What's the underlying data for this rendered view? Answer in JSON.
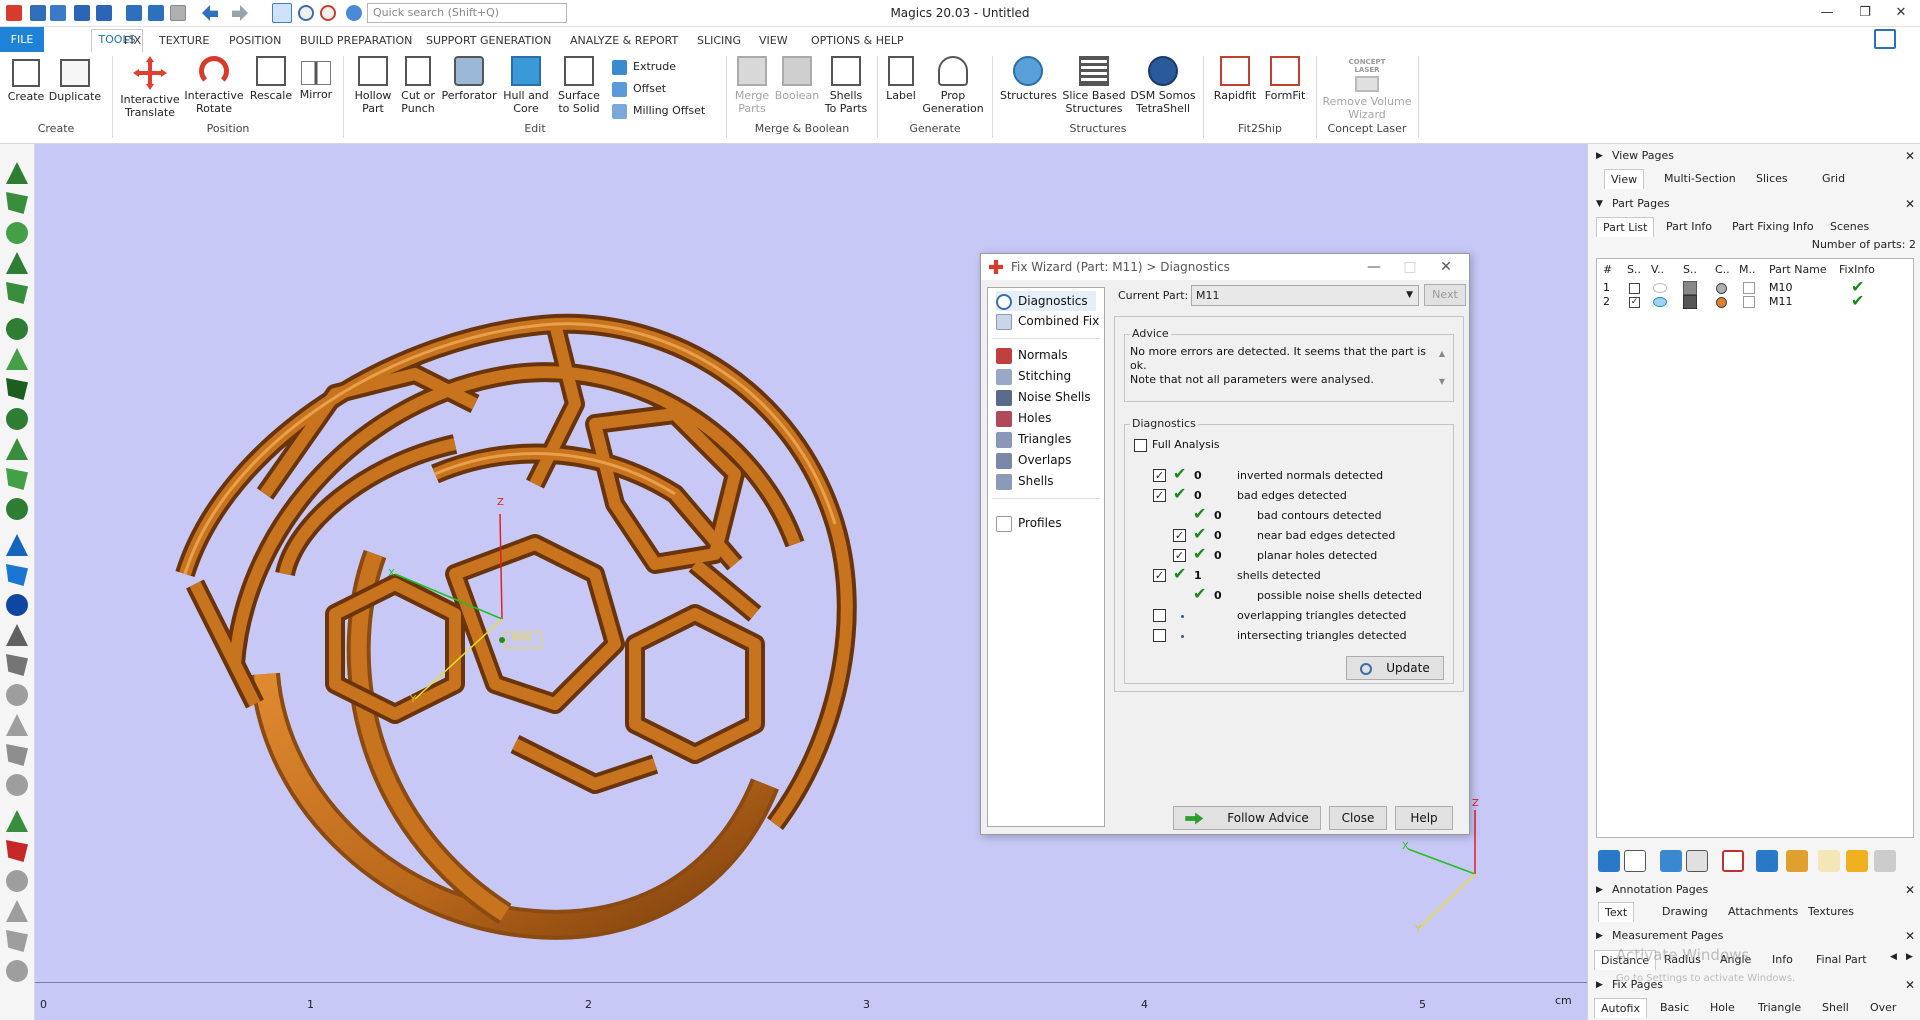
{
  "titlebar": {
    "title": "Magics 20.03 - Untitled",
    "search_placeholder": "Quick search (Shift+Q)"
  },
  "menu_tabs": [
    "FILE",
    "TOOLS",
    "FIX",
    "TEXTURE",
    "POSITION",
    "BUILD PREPARATION",
    "SUPPORT GENERATION",
    "ANALYZE & REPORT",
    "SLICING",
    "VIEW",
    "OPTIONS & HELP"
  ],
  "ribbon": {
    "create": {
      "create": "Create",
      "duplicate": "Duplicate",
      "group": "Create"
    },
    "position": {
      "translate": "Interactive\nTranslate",
      "rotate": "Interactive\nRotate",
      "rescale": "Rescale",
      "mirror": "Mirror",
      "group": "Position"
    },
    "edit": {
      "hollow": "Hollow\nPart",
      "cut": "Cut or\nPunch",
      "perforator": "Perforator",
      "hull": "Hull and\nCore",
      "surface": "Surface\nto Solid",
      "extrude": "Extrude",
      "offset": "Offset",
      "milling": "Milling Offset",
      "group": "Edit"
    },
    "merge": {
      "merge": "Merge\nParts",
      "boolean": "Boolean",
      "shells": "Shells\nTo Parts",
      "group": "Merge & Boolean"
    },
    "generate": {
      "label": "Label",
      "prop": "Prop\nGeneration",
      "group": "Generate"
    },
    "structures": {
      "structures": "Structures",
      "slice": "Slice Based\nStructures",
      "dsm": "DSM Somos\nTetraShell",
      "group": "Structures"
    },
    "fit2ship": {
      "rapidfit": "Rapidfit",
      "formfit": "FormFit",
      "group": "Fit2Ship"
    },
    "concept": {
      "badge": "CONCEPT\nLASER",
      "remove": "Remove Volume\nWizard",
      "group": "Concept Laser"
    }
  },
  "viewport": {
    "ruler_unit": "cm",
    "ruler_ticks": [
      "0",
      "1",
      "2",
      "3",
      "4",
      "5"
    ],
    "axis_labels": {
      "x": "X",
      "y": "Y",
      "z": "Z"
    },
    "pivot_label": "M06",
    "watermark": [
      "Activate Windows",
      "Go to Settings to activate Windows."
    ],
    "colors": {
      "background": "#c8c8f7",
      "part": "#c8731e"
    }
  },
  "fix_wizard": {
    "title": "Fix Wizard (Part: M11) > Diagnostics",
    "nav": [
      {
        "label": "Diagnostics",
        "selected": true
      },
      {
        "label": "Combined Fix"
      },
      {
        "label": "Normals"
      },
      {
        "label": "Stitching"
      },
      {
        "label": "Noise Shells"
      },
      {
        "label": "Holes"
      },
      {
        "label": "Triangles"
      },
      {
        "label": "Overlaps"
      },
      {
        "label": "Shells"
      },
      {
        "label": "Profiles"
      }
    ],
    "current_part_label": "Current Part:",
    "current_part_value": "M11",
    "next": "Next",
    "advice_title": "Advice",
    "advice_text": "No more errors are detected. It seems that the part is ok.\nNote that not all parameters were analysed.",
    "diagnostics_title": "Diagnostics",
    "full_analysis": "Full Analysis",
    "rows": [
      {
        "checked": true,
        "ok": true,
        "value": "0",
        "label": "inverted normals detected",
        "indent": 0
      },
      {
        "checked": true,
        "ok": true,
        "value": "0",
        "label": "bad edges detected",
        "indent": 0
      },
      {
        "checkbox": false,
        "ok": true,
        "value": "0",
        "label": "bad contours detected",
        "indent": 1
      },
      {
        "checked": true,
        "ok": true,
        "value": "0",
        "label": "near bad edges detected",
        "indent": 1
      },
      {
        "checked": true,
        "ok": true,
        "value": "0",
        "label": "planar holes detected",
        "indent": 1
      },
      {
        "checked": true,
        "ok": true,
        "value": "1",
        "label": "shells detected",
        "indent": 0
      },
      {
        "checkbox": false,
        "ok": true,
        "value": "0",
        "label": "possible noise shells detected",
        "indent": 1
      },
      {
        "checked": false,
        "ok": false,
        "value": "",
        "label": "overlapping triangles detected",
        "indent": 0
      },
      {
        "checked": false,
        "ok": false,
        "value": "",
        "label": "intersecting triangles detected",
        "indent": 0
      }
    ],
    "update": "Update",
    "follow_advice": "Follow Advice",
    "close": "Close",
    "help": "Help"
  },
  "right_panel": {
    "view_pages": "View Pages",
    "view_tabs": [
      "View",
      "Multi-Section",
      "Slices",
      "Grid"
    ],
    "part_pages": "Part Pages",
    "part_tabs": [
      "Part List",
      "Part Info",
      "Part Fixing Info",
      "Scenes"
    ],
    "num_parts": "Number of parts: 2",
    "columns": [
      "#",
      "S..",
      "V..",
      "S..",
      "C..",
      "M..",
      "Part Name",
      "FixInfo"
    ],
    "parts": [
      {
        "num": "1",
        "selected": false,
        "name": "M10",
        "color": "#b0b0b0"
      },
      {
        "num": "2",
        "selected": true,
        "name": "M11",
        "color": "#e0802a"
      }
    ],
    "annotation_pages": "Annotation Pages",
    "annotation_tabs": [
      "Text",
      "Drawing",
      "Attachments",
      "Textures"
    ],
    "measurement_pages": "Measurement Pages",
    "measurement_tabs": [
      "Distance",
      "Radius",
      "Angle",
      "Info",
      "Final Part"
    ],
    "fix_pages": "Fix Pages",
    "fix_tabs": [
      "Autofix",
      "Basic",
      "Hole",
      "Triangle",
      "Shell",
      "Over"
    ]
  }
}
